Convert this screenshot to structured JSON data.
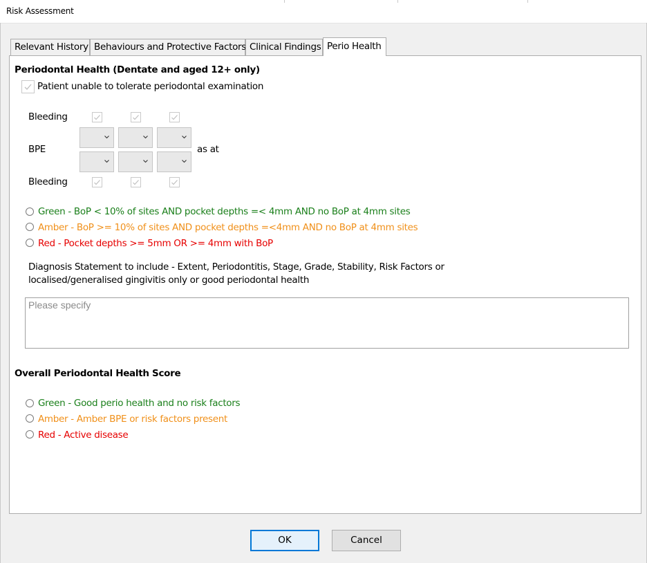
{
  "window": {
    "title": "Risk Assessment"
  },
  "tabs": [
    {
      "label": "Relevant History"
    },
    {
      "label": "Behaviours and Protective Factors"
    },
    {
      "label": "Clinical Findings"
    },
    {
      "label": "Perio Health"
    }
  ],
  "active_tab": "Perio Health",
  "perio": {
    "section_title": "Periodontal Health (Dentate and aged 12+ only)",
    "unable_label": "Patient unable to tolerate periodontal examination",
    "unable_checked": true,
    "unable_disabled": true,
    "bleeding_label": "Bleeding",
    "bpe_label": "BPE",
    "as_at_label": "as at",
    "bleeding_top": [
      true,
      true,
      true
    ],
    "bleeding_bottom": [
      true,
      true,
      true
    ],
    "bpe_values": [
      "",
      "",
      "",
      "",
      "",
      ""
    ],
    "status_options": [
      {
        "label": "Green - BoP < 10% of sites AND pocket depths =< 4mm AND no BoP at 4mm sites",
        "color": "#1a7f1a",
        "selected": false
      },
      {
        "label": "Amber - BoP >= 10% of sites AND pocket depths =<4mm AND no BoP at 4mm sites",
        "color": "#f0901a",
        "selected": false
      },
      {
        "label": "Red - Pocket depths >= 5mm OR >= 4mm with BoP",
        "color": "#e60000",
        "selected": false
      }
    ],
    "diagnosis_line1": "Diagnosis Statement to include - Extent, Periodontitis, Stage, Grade, Stability, Risk Factors or",
    "diagnosis_line2": "localised/generalised gingivitis only or good periodontal health",
    "diagnosis_placeholder": "Please specify",
    "diagnosis_value": ""
  },
  "overall": {
    "title": "Overall Periodontal Health Score",
    "options": [
      {
        "label": "Green - Good perio health and no risk factors",
        "color": "#1a7f1a",
        "selected": false
      },
      {
        "label": "Amber - Amber BPE or risk factors present",
        "color": "#f0901a",
        "selected": false
      },
      {
        "label": "Red - Active disease",
        "color": "#e60000",
        "selected": false
      }
    ]
  },
  "buttons": {
    "ok": "OK",
    "cancel": "Cancel"
  }
}
